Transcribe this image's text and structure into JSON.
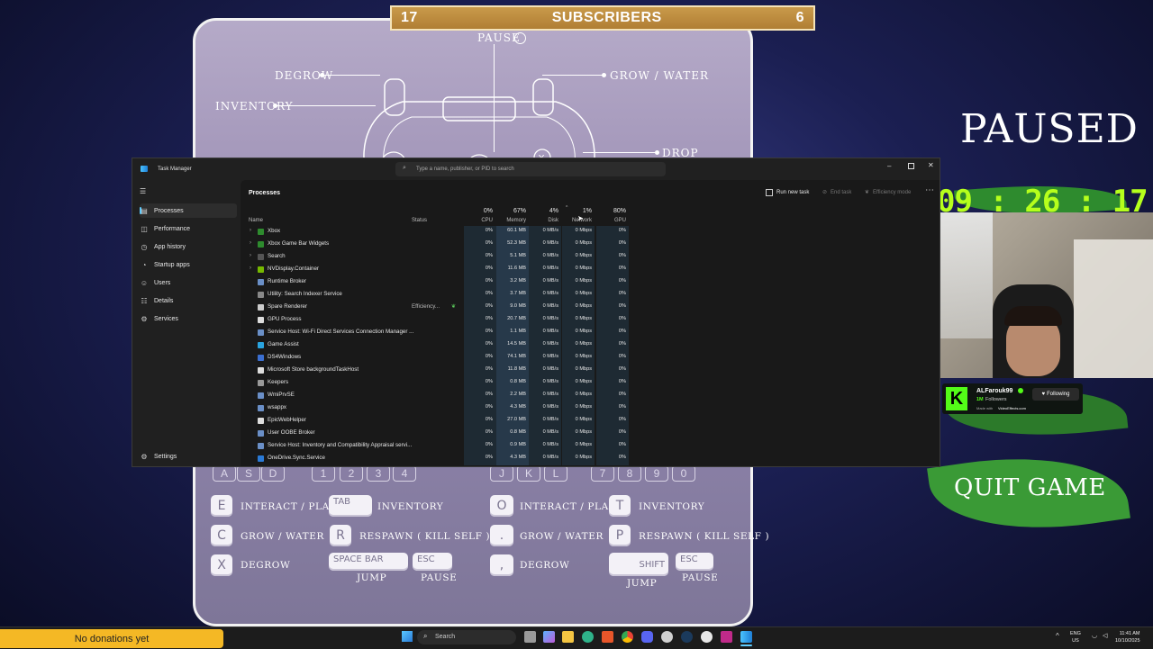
{
  "game": {
    "subscribers": {
      "left_count": "17",
      "label": "SUBSCRIBERS",
      "right_count": "6"
    },
    "paused_title": "PAUSED",
    "timer": "09 : 26 : 17",
    "quit_label": "QUIT GAME",
    "controller": {
      "pause": "PAUSE",
      "degrow": "DEGROW",
      "inventory": "INVENTORY",
      "grow_water": "GROW / WATER",
      "drop": "DROP"
    },
    "p1_keys": {
      "ghost": [
        "A",
        "S",
        "D",
        "1",
        "2",
        "3",
        "4"
      ],
      "interact_key": "E",
      "interact_label": "INTERACT / PLANT",
      "tab_key": "TAB",
      "inventory_label": "INVENTORY",
      "grow_key": "C",
      "grow_label": "GROW / WATER",
      "respawn_key": "R",
      "respawn_label": "RESPAWN ( KILL SELF )",
      "degrow_key": "X",
      "degrow_label": "DEGROW",
      "jump_key": "SPACE BAR",
      "jump_label": "JUMP",
      "pause_key": "ESC",
      "pause_label": "PAUSE"
    },
    "p2_keys": {
      "ghost": [
        "J",
        "K",
        "L",
        "7",
        "8",
        "9",
        "0"
      ],
      "interact_key": "O",
      "interact_label": "INTERACT / PLANT",
      "inventory_key": "T",
      "inventory_label": "INVENTORY",
      "grow_key": ".",
      "grow_label": "GROW / WATER",
      "respawn_key": "P",
      "respawn_label": "RESPAWN ( KILL SELF )",
      "degrow_key": ",",
      "degrow_label": "DEGROW",
      "jump_key": "SHIFT",
      "jump_label": "JUMP",
      "pause_key": "ESC",
      "pause_label": "PAUSE"
    }
  },
  "streamer": {
    "name": "ALFarouk99",
    "followers": "1M",
    "followers_label": "Followers",
    "following_label": "Following",
    "made_with": "Made with",
    "made_with_brand": "VideoEffects.com"
  },
  "taskmgr": {
    "title": "Task Manager",
    "search_placeholder": "Type a name, publisher, or PID to search",
    "page_title": "Processes",
    "run_new_task": "Run new task",
    "end_task": "End task",
    "efficiency_mode": "Efficiency mode",
    "nav": [
      "Processes",
      "Performance",
      "App history",
      "Startup apps",
      "Users",
      "Details",
      "Services"
    ],
    "settings": "Settings",
    "columns": {
      "name": "Name",
      "status": "Status",
      "cpu_pct": "0%",
      "cpu": "CPU",
      "mem_pct": "67%",
      "mem": "Memory",
      "disk_pct": "4%",
      "disk": "Disk",
      "net_pct": "1%",
      "net": "Network",
      "gpu_pct": "80%",
      "gpu": "GPU"
    },
    "rows": [
      {
        "name": "Xbox",
        "status": "",
        "cpu": "0%",
        "mem": "60.1 MB",
        "disk": "0 MB/s",
        "net": "0 Mbps",
        "gpu": "0%",
        "expand": true,
        "icon": "#2e8b2e"
      },
      {
        "name": "Xbox Game Bar Widgets",
        "status": "",
        "cpu": "0%",
        "mem": "52.3 MB",
        "disk": "0 MB/s",
        "net": "0 Mbps",
        "gpu": "0%",
        "expand": true,
        "icon": "#2e8b2e"
      },
      {
        "name": "Search",
        "status": "",
        "cpu": "0%",
        "mem": "5.1 MB",
        "disk": "0 MB/s",
        "net": "0 Mbps",
        "gpu": "0%",
        "expand": true,
        "icon": "#555555"
      },
      {
        "name": "NVDisplay.Container",
        "status": "",
        "cpu": "0%",
        "mem": "11.6 MB",
        "disk": "0 MB/s",
        "net": "0 Mbps",
        "gpu": "0%",
        "expand": true,
        "icon": "#76b900"
      },
      {
        "name": "Runtime Broker",
        "status": "",
        "cpu": "0%",
        "mem": "3.2 MB",
        "disk": "0 MB/s",
        "net": "0 Mbps",
        "gpu": "0%",
        "expand": false,
        "icon": "#6a8fc7"
      },
      {
        "name": "Utility: Search Indexer Service",
        "status": "",
        "cpu": "0%",
        "mem": "3.7 MB",
        "disk": "0 MB/s",
        "net": "0 Mbps",
        "gpu": "0%",
        "expand": false,
        "icon": "#888888"
      },
      {
        "name": "Spare Renderer",
        "status": "Efficiency...",
        "cpu": "0%",
        "mem": "9.0 MB",
        "disk": "0 MB/s",
        "net": "0 Mbps",
        "gpu": "0%",
        "expand": false,
        "icon": "#cccccc"
      },
      {
        "name": "GPU Process",
        "status": "",
        "cpu": "0%",
        "mem": "20.7 MB",
        "disk": "0 MB/s",
        "net": "0 Mbps",
        "gpu": "0%",
        "expand": false,
        "icon": "#dddddd"
      },
      {
        "name": "Service Host: Wi-Fi Direct Services Connection Manager ...",
        "status": "",
        "cpu": "0%",
        "mem": "1.1 MB",
        "disk": "0 MB/s",
        "net": "0 Mbps",
        "gpu": "0%",
        "expand": false,
        "icon": "#6a8fc7"
      },
      {
        "name": "Game Assist",
        "status": "",
        "cpu": "0%",
        "mem": "14.5 MB",
        "disk": "0 MB/s",
        "net": "0 Mbps",
        "gpu": "0%",
        "expand": false,
        "icon": "#2aa4e0"
      },
      {
        "name": "DS4Windows",
        "status": "",
        "cpu": "0%",
        "mem": "74.1 MB",
        "disk": "0 MB/s",
        "net": "0 Mbps",
        "gpu": "0%",
        "expand": false,
        "icon": "#3b6fd1"
      },
      {
        "name": "Microsoft Store backgroundTaskHost",
        "status": "",
        "cpu": "0%",
        "mem": "11.8 MB",
        "disk": "0 MB/s",
        "net": "0 Mbps",
        "gpu": "0%",
        "expand": false,
        "icon": "#dddddd"
      },
      {
        "name": "Keepers",
        "status": "",
        "cpu": "0%",
        "mem": "0.8 MB",
        "disk": "0 MB/s",
        "net": "0 Mbps",
        "gpu": "0%",
        "expand": false,
        "icon": "#999999"
      },
      {
        "name": "WmiPrvSE",
        "status": "",
        "cpu": "0%",
        "mem": "2.2 MB",
        "disk": "0 MB/s",
        "net": "0 Mbps",
        "gpu": "0%",
        "expand": false,
        "icon": "#6a8fc7"
      },
      {
        "name": "wsappx",
        "status": "",
        "cpu": "0%",
        "mem": "4.3 MB",
        "disk": "0 MB/s",
        "net": "0 Mbps",
        "gpu": "0%",
        "expand": false,
        "icon": "#6a8fc7"
      },
      {
        "name": "EpicWebHelper",
        "status": "",
        "cpu": "0%",
        "mem": "27.0 MB",
        "disk": "0 MB/s",
        "net": "0 Mbps",
        "gpu": "0%",
        "expand": false,
        "icon": "#dddddd"
      },
      {
        "name": "User OOBE Broker",
        "status": "",
        "cpu": "0%",
        "mem": "0.8 MB",
        "disk": "0 MB/s",
        "net": "0 Mbps",
        "gpu": "0%",
        "expand": false,
        "icon": "#6a8fc7"
      },
      {
        "name": "Service Host: Inventory and Compatibility Appraisal servi...",
        "status": "",
        "cpu": "0%",
        "mem": "0.9 MB",
        "disk": "0 MB/s",
        "net": "0 Mbps",
        "gpu": "0%",
        "expand": false,
        "icon": "#6a8fc7"
      },
      {
        "name": "OneDrive.Sync.Service",
        "status": "",
        "cpu": "0%",
        "mem": "4.3 MB",
        "disk": "0 MB/s",
        "net": "0 Mbps",
        "gpu": "0%",
        "expand": false,
        "icon": "#2a7ad6"
      }
    ]
  },
  "taskbar": {
    "donations": "No donations yet",
    "search": "Search",
    "lang_top": "ENG",
    "lang_bottom": "US",
    "time": "11:41 AM",
    "date": "10/10/2025"
  }
}
